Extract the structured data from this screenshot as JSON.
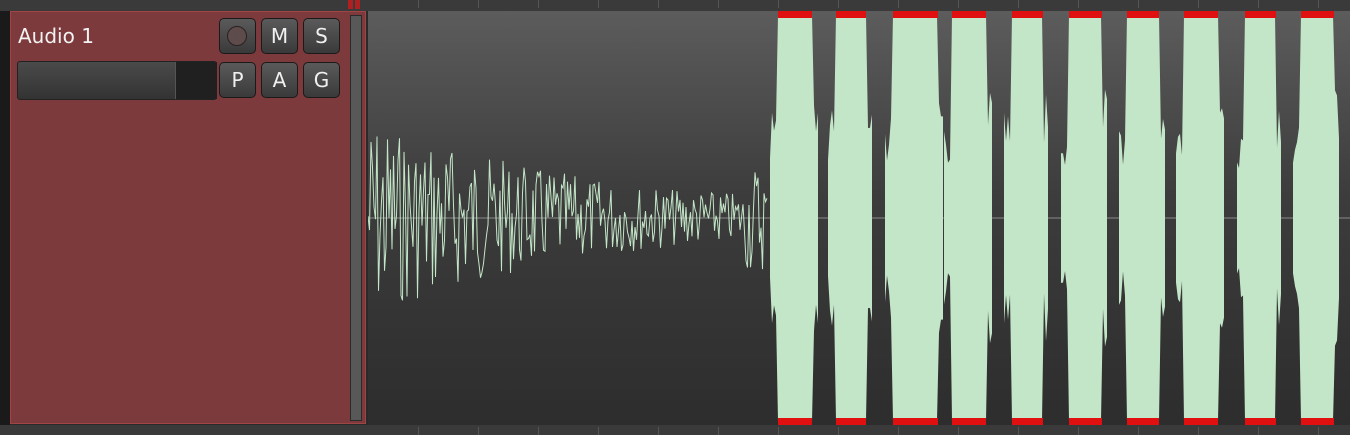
{
  "track": {
    "name": "Audio 1",
    "color": "#7d3a3c",
    "buttons": {
      "mute": "M",
      "solo": "S",
      "playlist": "P",
      "automation": "A",
      "group": "G"
    }
  },
  "waveform": {
    "color": "#c4e6c8",
    "clip_color": "#e01010"
  }
}
